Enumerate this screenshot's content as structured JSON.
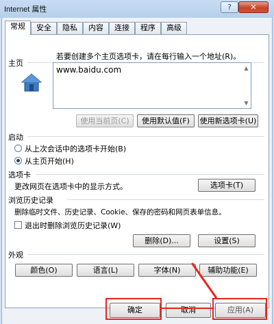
{
  "window": {
    "title": "Internet 属性",
    "help_label": "?",
    "close_label": "✕"
  },
  "tabs": [
    {
      "label": "常规",
      "active": true
    },
    {
      "label": "安全"
    },
    {
      "label": "隐私"
    },
    {
      "label": "内容"
    },
    {
      "label": "连接"
    },
    {
      "label": "程序"
    },
    {
      "label": "高级"
    }
  ],
  "homepage": {
    "heading": "主页",
    "hint": "若要创建多个主页选项卡，请在每行输入一个地址(R)。",
    "url": "www.baidu.com",
    "use_current": "使用当前页(C)",
    "use_default": "使用默认值(F)",
    "use_new_tab": "使用新选项卡(U)"
  },
  "startup": {
    "heading": "启动",
    "option_last_session": "从上次会话中的选项卡开始(B)",
    "option_homepage": "从主页开始(H)"
  },
  "tabs_section": {
    "heading": "选项卡",
    "description": "更改网页在选项卡中的显示方式。",
    "button": "选项卡(T)"
  },
  "history": {
    "heading": "浏览历史记录",
    "description": "删除临时文件、历史记录、Cookie、保存的密码和网页表单信息。",
    "delete_on_exit": "退出时删除浏览历史记录(W)",
    "delete_button": "删除(D)...",
    "settings_button": "设置(S)"
  },
  "appearance": {
    "heading": "外观",
    "colors": "颜色(O)",
    "languages": "语言(L)",
    "fonts": "字体(N)",
    "accessibility": "辅助功能(E)"
  },
  "footer": {
    "ok": "确定",
    "cancel": "取消",
    "apply": "应用(A)"
  },
  "colors": {
    "highlight": "#e8231b"
  }
}
